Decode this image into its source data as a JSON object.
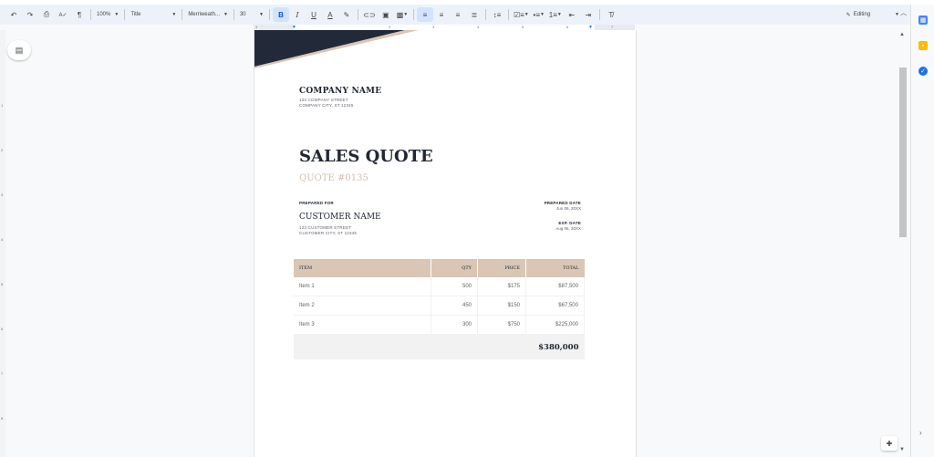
{
  "toolbar": {
    "zoom": "100%",
    "style": "Title",
    "font": "Merriweath...",
    "font_size": "30",
    "mode": "Editing"
  },
  "ruler": {
    "h_ticks": [
      "1",
      "2",
      "3",
      "4",
      "5",
      "6",
      "7"
    ],
    "v_ticks": [
      "1",
      "2",
      "3",
      "4",
      "5",
      "6",
      "7",
      "8",
      "9"
    ]
  },
  "document": {
    "company_name": "COMPANY NAME",
    "company_street": "123 COMPANY STREET",
    "company_city": "COMPANY CITY, ST 12345",
    "title": "SALES QUOTE",
    "quote_number": "QUOTE #0135",
    "prepared_for_label": "PREPARED FOR",
    "customer_name": "CUSTOMER NAME",
    "customer_street": "123 CUSTOMER STREET",
    "customer_city": "CUSTOMER CITY, ST 12345",
    "prepared_date_label": "PREPARED DATE",
    "prepared_date": "Jun 06, 20XX",
    "exp_date_label": "EXP. DATE",
    "exp_date": "Aug 06, 20XX",
    "table": {
      "headers": [
        "ITEM",
        "QTY",
        "PRICE",
        "TOTAL"
      ],
      "rows": [
        {
          "item": "Item 1",
          "qty": "500",
          "price": "$175",
          "total": "$87,500"
        },
        {
          "item": "Item 2",
          "qty": "450",
          "price": "$150",
          "total": "$67,500"
        },
        {
          "item": "Item 3",
          "qty": "300",
          "price": "$750",
          "total": "$225,000"
        }
      ],
      "grand_total": "$380,000"
    }
  },
  "colors": {
    "accent_tan": "#dac6b5",
    "navy": "#222833",
    "toolbar_bg": "#edf2fa"
  }
}
